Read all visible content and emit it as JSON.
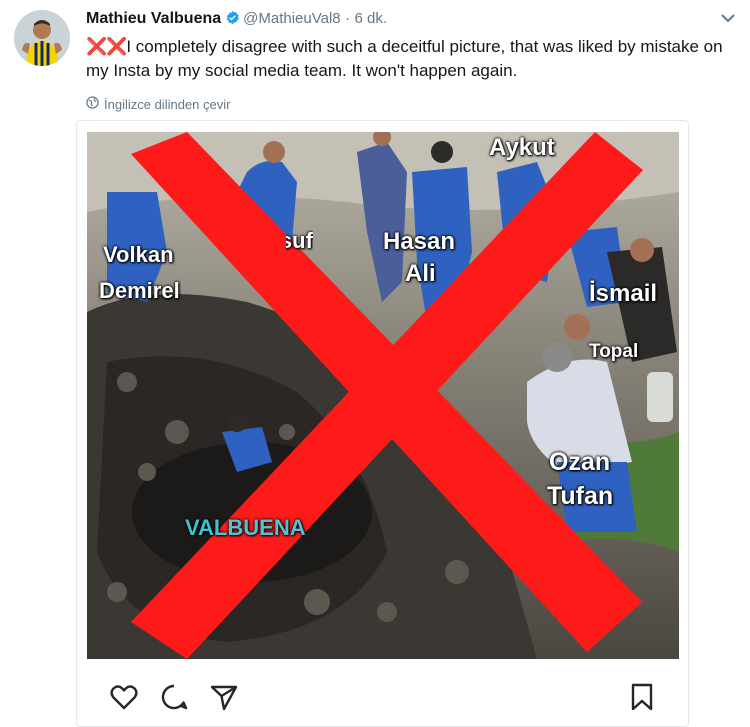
{
  "tweet": {
    "author_name": "Mathieu Valbuena",
    "handle": "@MathieuVal8",
    "separator": "·",
    "time": "6 dk.",
    "emoji_prefix": "❌❌",
    "text": "I completely disagree with such a deceitful picture, that was liked by mistake on my Insta by my social media team. It won't happen again.",
    "translate_label": "İngilizce dilinden çevir"
  },
  "image_labels": {
    "aykut": "Aykut",
    "volkan": "Volkan",
    "demirel": "Demirel",
    "yusuf": "Yusuf",
    "hasan": "Hasan",
    "ali": "Ali",
    "ismail": "İsmail",
    "topal": "Topal",
    "ozan": "Ozan",
    "tufan": "Tufan",
    "valbuena": "VALBUENA"
  },
  "icons": {
    "verified": "verified-badge-icon",
    "caret": "chevron-down-icon",
    "globe": "globe-icon",
    "like": "heart-icon",
    "comment": "speech-bubble-icon",
    "share": "paper-plane-icon",
    "save": "bookmark-icon"
  },
  "colors": {
    "verified_blue": "#1da1f2",
    "x_red": "#ff1a1a",
    "label_cyan": "#3fd7e8"
  }
}
